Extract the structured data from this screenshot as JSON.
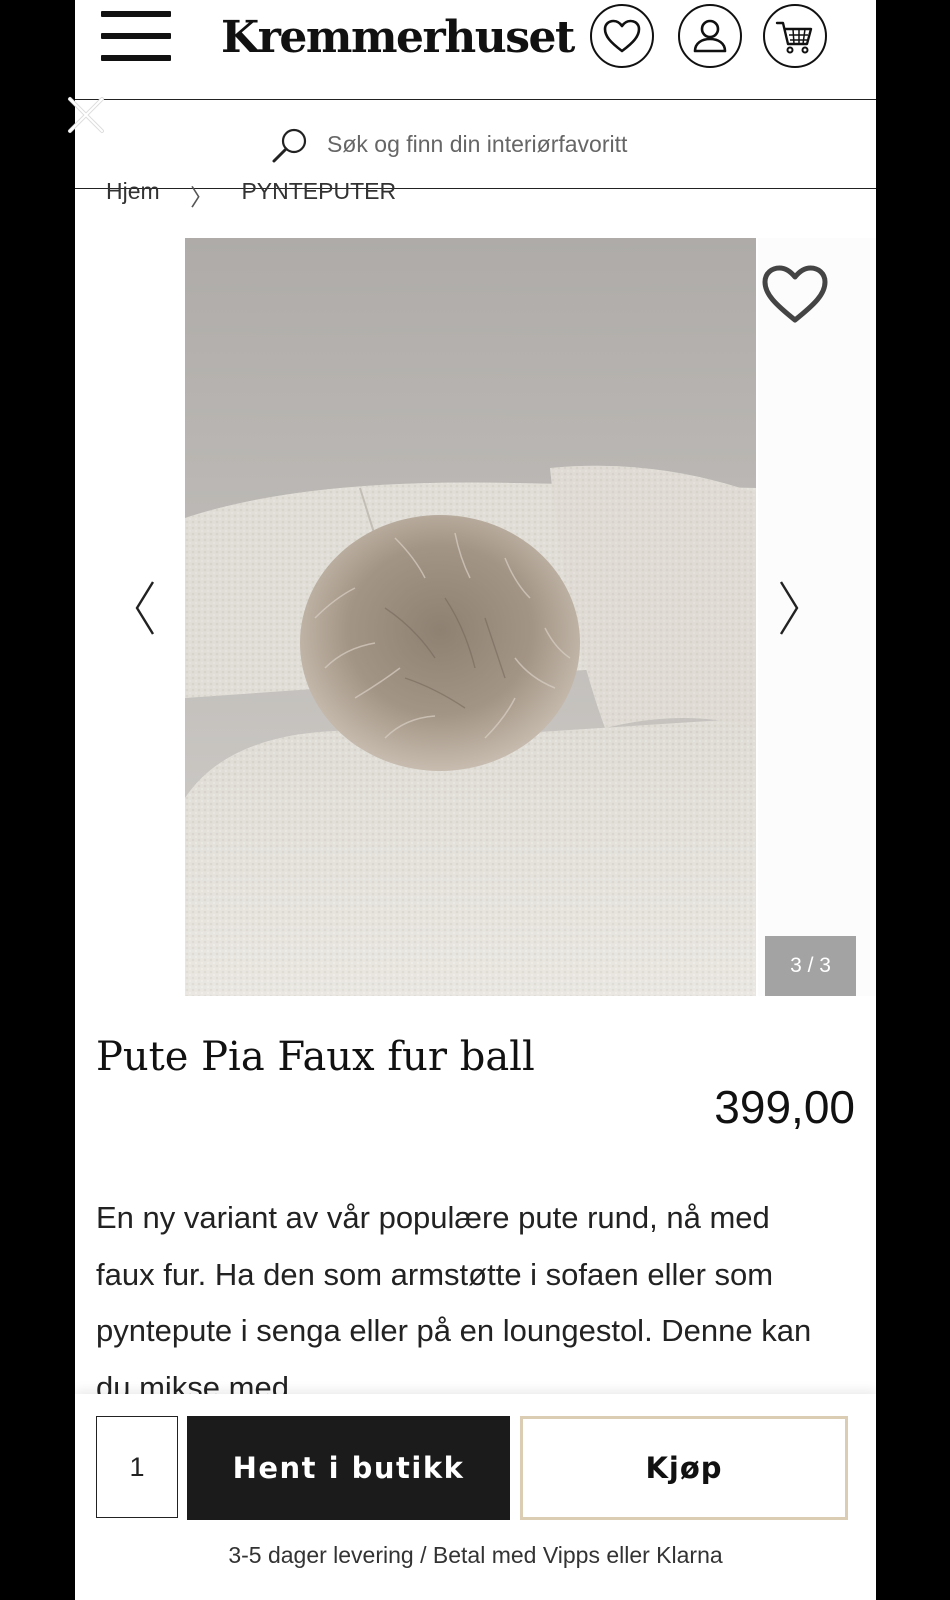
{
  "header": {
    "brand": "Kremmerhuset",
    "icons": [
      "menu-icon",
      "heart-icon",
      "user-icon",
      "cart-icon",
      "close-icon"
    ]
  },
  "search": {
    "placeholder": "Søk og finn din interiørfavoritt"
  },
  "breadcrumb": {
    "home": "Hjem",
    "separator": "〉",
    "current": "PYNTEPUTER"
  },
  "gallery": {
    "counter": "3 / 3",
    "image_alt": "Faux fur ball pillow on a white boucle sofa"
  },
  "product": {
    "title": "Pute Pia Faux fur ball",
    "price": "399,00",
    "description": "En ny variant av vår populære pute rund, nå med faux fur. Ha den som armstøtte i sofaen eller som pyntepute i senga eller på en loungestol. Denne kan du mikse med"
  },
  "purchase": {
    "quantity": "1",
    "pickup_label": "Hent i butikk",
    "buy_label": "Kjøp",
    "info": "3-5 dager levering / Betal med Vipps eller Klarna",
    "buy_border_color": "#dacdb4"
  }
}
